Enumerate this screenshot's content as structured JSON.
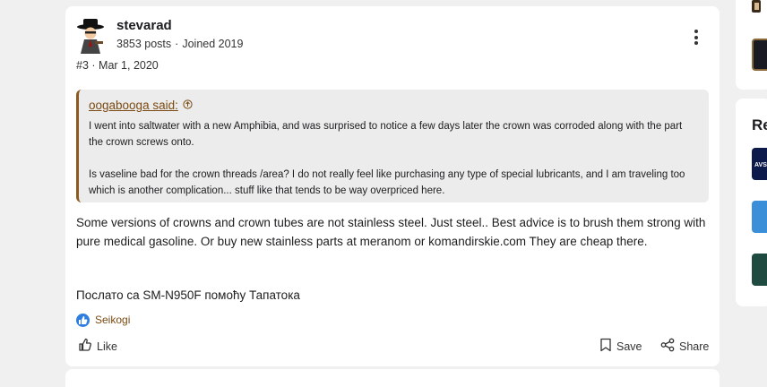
{
  "post": {
    "username": "stevarad",
    "posts": "3853 posts",
    "joined": "Joined 2019",
    "post_number": "#3",
    "date": "Mar 1, 2020",
    "quote": {
      "author": "oogabooga said:",
      "paragraphs": [
        "I went into saltwater with a new Amphibia, and was surprised to notice a few days later the crown was corroded along with the part the crown screws onto.",
        "Is vaseline bad for the crown threads /area? I do not really feel like purchasing any type of special lubricants, and I am traveling too which is another complication... stuff like that tends to be way overpriced here."
      ]
    },
    "body": "Some versions of crowns and crown tubes are not stainless steel. Just steel.. Best advice is to brush them strong with pure medical gasoline. Or buy new stainless parts at meranom or komandirskie.com They are cheap there.",
    "signature": "Послато са SM-N950F помоћу Тапатока",
    "reaction_user": "Seikogi",
    "actions": {
      "like": "Like",
      "save": "Save",
      "share": "Share"
    }
  },
  "sidebar": {
    "heading": "Re"
  },
  "colors": {
    "accent": "#7a4a12",
    "like_blue": "#2e7de0",
    "page_bg": "#f0f0f1"
  }
}
